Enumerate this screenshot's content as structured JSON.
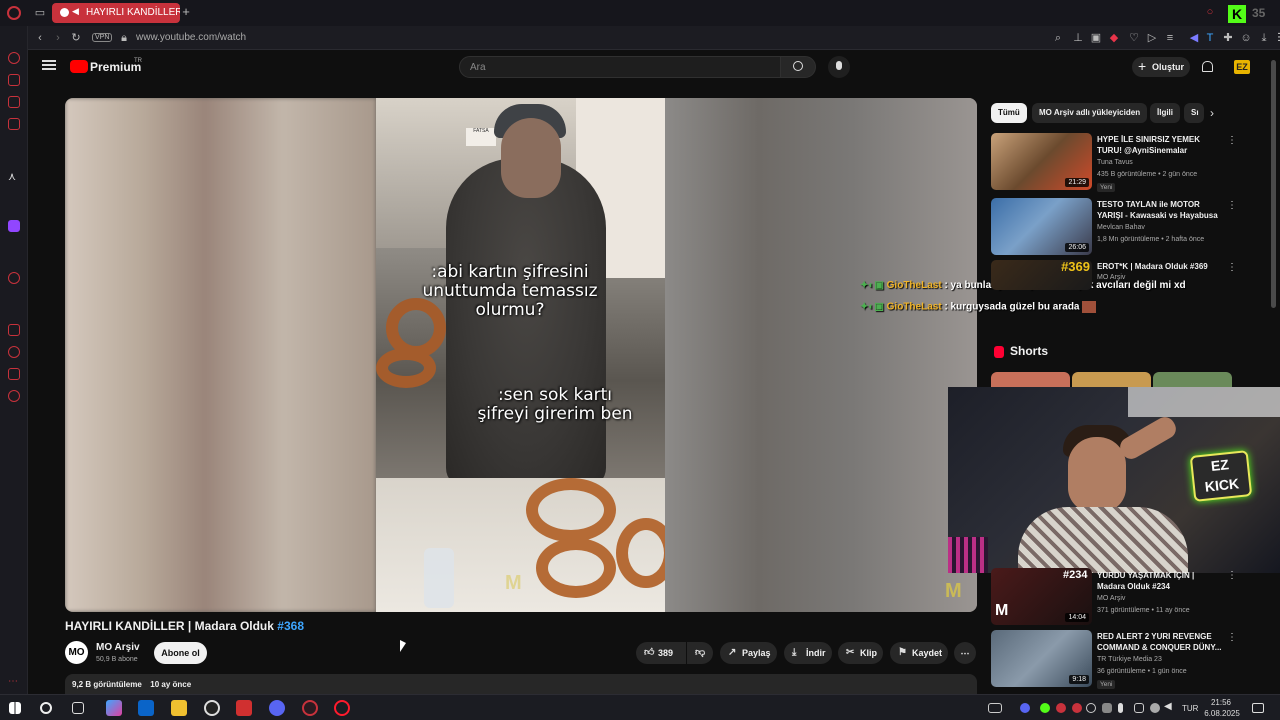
{
  "browser": {
    "tab_title": "HAYIRLI KANDİLLER |",
    "url": "www.youtube.com/watch",
    "vpn_label": "VPN"
  },
  "youtube": {
    "logo_label": "Premium",
    "logo_sup": "TR",
    "search_placeholder": "Ara",
    "create_label": "Oluştur"
  },
  "video": {
    "overlay_line1": ":abi kartın şifresini\nunuttumda temassız\nolurmu?",
    "overlay_line2": ":sen sok kartı\nşifreyi girerim ben",
    "title": "HAYIRLI KANDİLLER | Madara Olduk",
    "title_hashtag": "#368",
    "channel_name": "MO Arşiv",
    "channel_subs": "50,9 B abone",
    "subscribe_label": "Abone ol",
    "like_count": "389",
    "share_label": "Paylaş",
    "download_label": "İndir",
    "clip_label": "Klip",
    "save_label": "Kaydet",
    "views": "9,2 B görüntüleme",
    "age": "10 ay önce"
  },
  "chips": [
    "Tümü",
    "MO Arşiv adlı yükleyiciden",
    "İlgili",
    "Sı"
  ],
  "recommendations": [
    {
      "title": "HYPE İLE SINIRSIZ YEMEK TURU! @AyniSinemalar",
      "channel": "Tuna Tavus",
      "meta": "435 B görüntüleme • 2 gün önce",
      "badge": "Yeni",
      "duration": "21:29"
    },
    {
      "title": "TESTO TAYLAN ile MOTOR YARIŞI - Kawasaki vs Hayabusa",
      "channel": "Mevlcan Bahav",
      "meta": "1,8 Mn görüntüleme • 2 hafta önce",
      "badge": "",
      "duration": "26:06"
    },
    {
      "title": "EROT*K | Madara Olduk #369",
      "channel": "MO Arşiv",
      "meta": "",
      "badge": "",
      "duration": "",
      "thumb_tag": "#369"
    },
    {
      "title": "YURDU YAŞATMAK İÇİN | Madara Olduk #234",
      "channel": "MO Arşiv",
      "meta": "371 görüntüleme • 11 ay önce",
      "badge": "",
      "duration": "14:04",
      "thumb_tag": "#234"
    },
    {
      "title": "RED ALERT 2 YURI REVENGE COMMAND & CONQUER DÜNY...",
      "channel": "TR Türkiye Media 23",
      "meta": "36 görüntüleme • 1 gün önce",
      "badge": "Yeni",
      "duration": "9:18"
    }
  ],
  "shorts_label": "Shorts",
  "chat": [
    {
      "user": "GioTheLast",
      "message": ": ya bunlar yurt dışındaki kaçak avcıları değil mi xd"
    },
    {
      "user": "GioTheLast",
      "message": ": kurguysada güzel bu arada"
    }
  ],
  "webcam_sign": "EZ KICK",
  "taskbar": {
    "lang": "TUR",
    "time": "21:56",
    "date": "6.08.2025"
  },
  "colors": {
    "opera_red": "#c8323c",
    "yt_bg": "#0f0f0f",
    "link_blue": "#3ea6ff",
    "chat_user": "#f0b429",
    "kick_green": "#53fc18"
  }
}
